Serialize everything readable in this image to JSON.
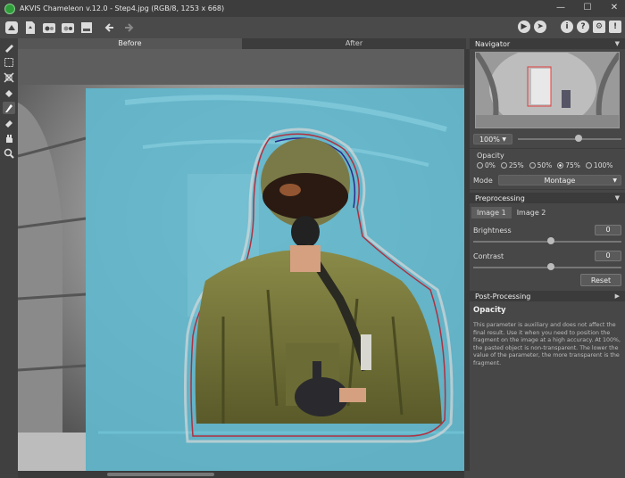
{
  "window": {
    "title": "AKVIS Chameleon v.12.0 - Step4.jpg (RGB/8, 1253 x 668)",
    "controls": [
      "minimize-icon",
      "maximize-icon",
      "close-icon"
    ]
  },
  "toolbar": {
    "left_icons": [
      "home-icon",
      "open-file-icon",
      "load-fragment-icon",
      "save-icon",
      "print-icon",
      "undo-icon",
      "redo-icon"
    ],
    "right_icons": [
      "run-icon",
      "export-icon",
      "info-icon",
      "help-icon",
      "settings-icon",
      "notifications-icon"
    ]
  },
  "tools": [
    "selection-brush-icon",
    "rect-select-icon",
    "transform-icon",
    "fill-tool-icon",
    "chameleon-brush-icon",
    "eraser-icon",
    "hand-icon",
    "zoom-icon"
  ],
  "view_tabs": {
    "before": "Before",
    "after": "After"
  },
  "navigator": {
    "title": "Navigator",
    "zoom": "100%",
    "zoom_level": 0.55
  },
  "opacity": {
    "label": "Opacity",
    "options": [
      "0%",
      "25%",
      "50%",
      "75%",
      "100%"
    ],
    "selected": "75%"
  },
  "mode": {
    "label": "Mode",
    "value": "Montage"
  },
  "preprocessing": {
    "title": "Preprocessing",
    "tabs": [
      "Image 1",
      "Image 2"
    ],
    "active_tab": "Image 1",
    "brightness": {
      "label": "Brightness",
      "value": "0"
    },
    "contrast": {
      "label": "Contrast",
      "value": "0"
    },
    "reset": "Reset"
  },
  "postprocessing": {
    "title": "Post-Processing"
  },
  "help": {
    "title": "Opacity",
    "text": "This parameter is auxiliary and does not affect the final result. Use it when you need to position the fragment on the image at a high accuracy. At 100%, the pasted object is non-transparent. The lower the value of the parameter, the more transparent is the fragment."
  }
}
